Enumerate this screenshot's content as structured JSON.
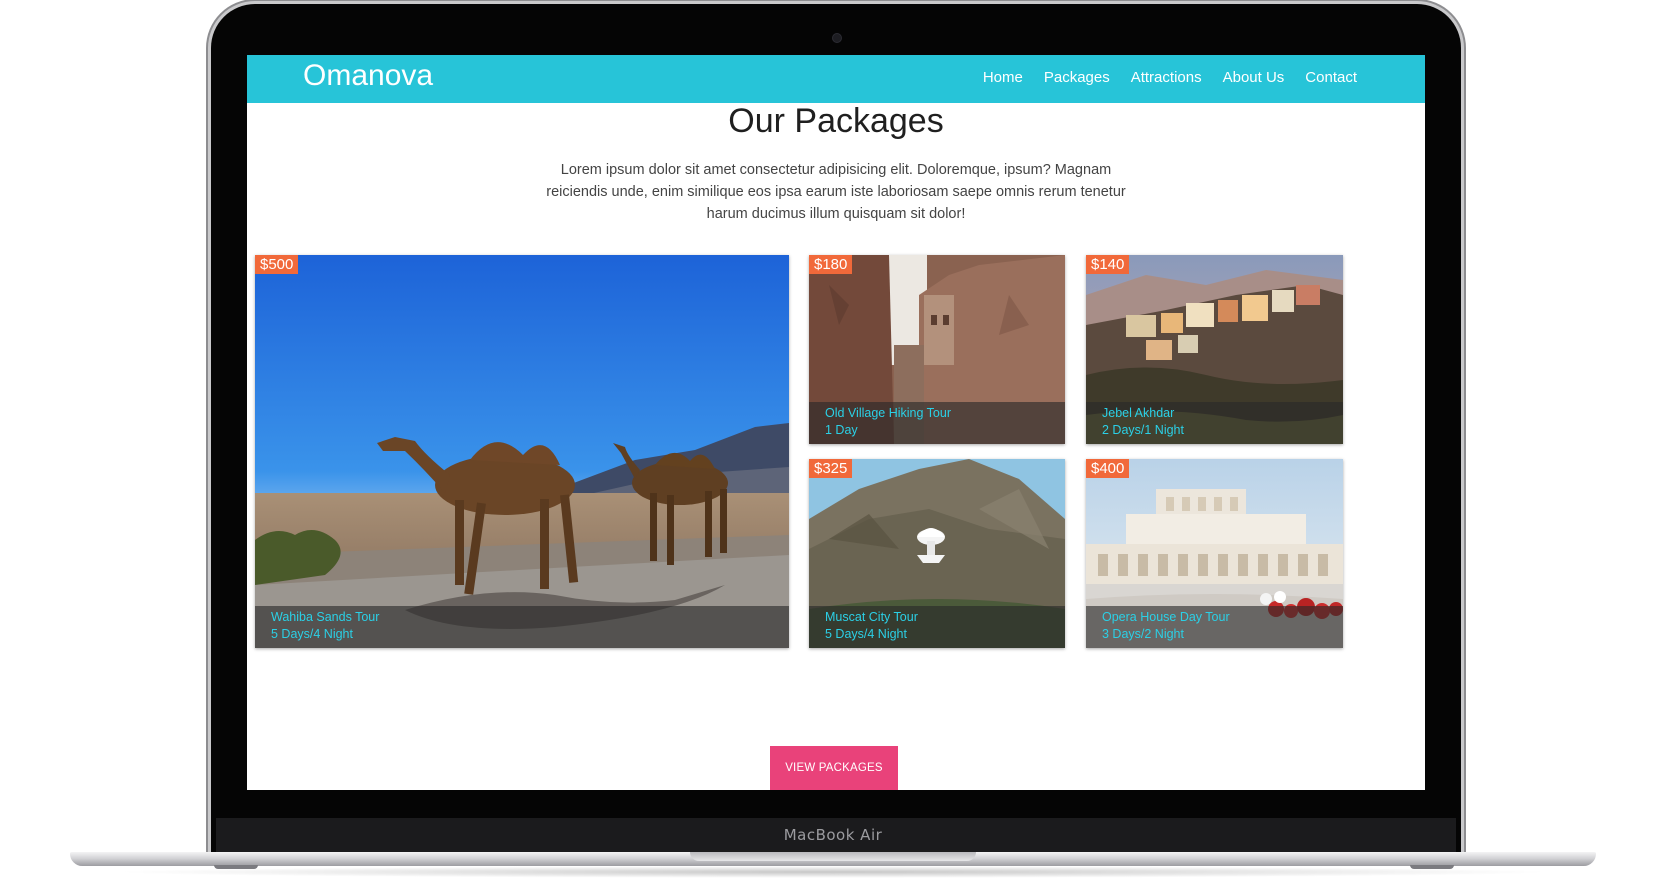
{
  "device": {
    "label": "MacBook Air"
  },
  "navbar": {
    "brand": "Omanova",
    "links": [
      "Home",
      "Packages",
      "Attractions",
      "About Us",
      "Contact"
    ],
    "background_color": "#27c4d8"
  },
  "section": {
    "title": "Our Packages",
    "description": "Lorem ipsum dolor sit amet consectetur adipisicing elit. Doloremque, ipsum? Magnam reiciendis unde, enim similique eos ipsa earum iste laboriosam saepe omnis rerum tenetur harum ducimus illum quisquam sit dolor!"
  },
  "packages": [
    {
      "price": "$500",
      "name": "Wahiba Sands Tour",
      "duration": "5 Days/4 Night",
      "image": "camels-desert-photo"
    },
    {
      "price": "$180",
      "name": "Old Village Hiking Tour",
      "duration": "1 Day",
      "image": "old-village-alley-photo"
    },
    {
      "price": "$140",
      "name": "Jebel Akhdar",
      "duration": "2 Days/1 Night",
      "image": "mountain-village-photo"
    },
    {
      "price": "$325",
      "name": "Muscat City Tour",
      "duration": "5 Days/4 Night",
      "image": "muscat-incense-burner-photo"
    },
    {
      "price": "$400",
      "name": "Opera House Day Tour",
      "duration": "3 Days/2 Night",
      "image": "opera-house-photo"
    }
  ],
  "cta": {
    "label": "VIEW PACKAGES",
    "color": "#e9427a"
  },
  "colors": {
    "price_badge": "#f1693a",
    "caption_text": "#2bd0e6"
  }
}
